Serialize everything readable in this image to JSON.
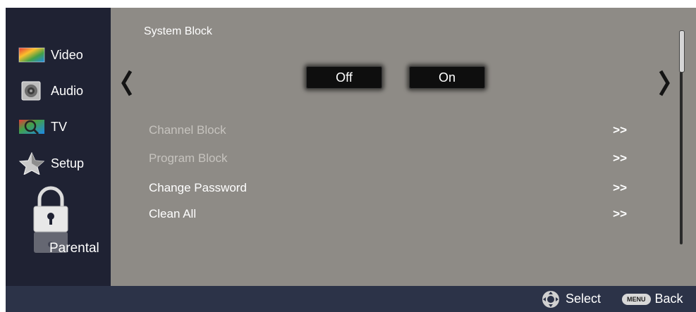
{
  "sidebar": {
    "items": [
      {
        "label": "Video",
        "icon": "video-icon"
      },
      {
        "label": "Audio",
        "icon": "speaker-icon"
      },
      {
        "label": "TV",
        "icon": "tv-icon"
      },
      {
        "label": "Setup",
        "icon": "star-icon"
      },
      {
        "label": "Parental",
        "icon": "lock-icon",
        "selected": true
      }
    ]
  },
  "main": {
    "title": "System Block",
    "options": [
      "Off",
      "On"
    ],
    "menu": [
      {
        "label": "Channel Block",
        "action": ">>",
        "enabled": false
      },
      {
        "label": "Program Block",
        "action": ">>",
        "enabled": false
      },
      {
        "label": "Change Password",
        "action": ">>",
        "enabled": true
      },
      {
        "label": "Clean All",
        "action": ">>",
        "enabled": true
      }
    ]
  },
  "footer": {
    "select_label": "Select",
    "menu_key": "MENU",
    "back_label": "Back"
  },
  "colors": {
    "sidebar_bg": "#1f2233",
    "panel_bg": "#8e8b86",
    "footer_bg": "#2c3348",
    "button_bg": "#0e0e0e"
  }
}
